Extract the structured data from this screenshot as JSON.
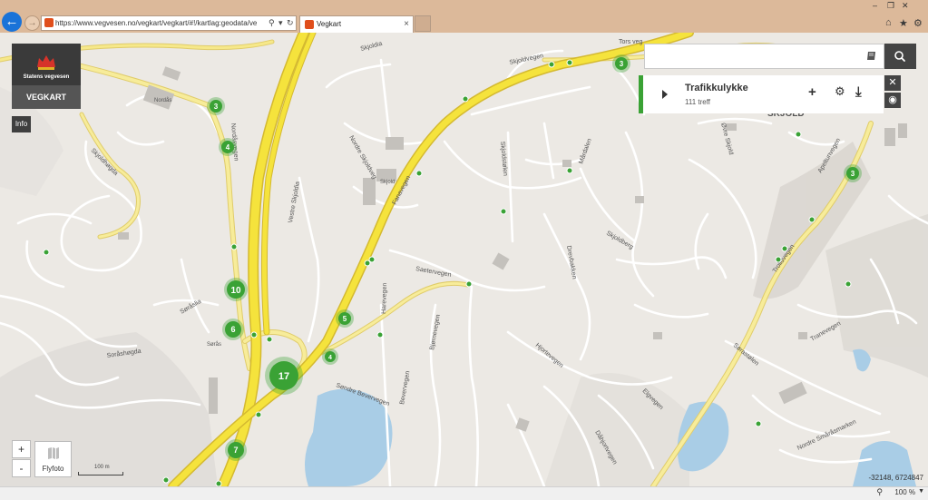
{
  "browser": {
    "url": "https://www.vegvesen.no/vegkart/vegkart/#!/kartlag:geodata/vegre",
    "tab_title": "Vegkart",
    "tab_close": "×",
    "zoom_level": "100 %",
    "icons": [
      "back-icon",
      "forward-icon",
      "search-icon",
      "dropdown-icon",
      "refresh-icon",
      "home-icon",
      "star-icon",
      "gear-icon",
      "minimize-icon",
      "restore-icon",
      "close-icon"
    ]
  },
  "app": {
    "org_name": "Statens vegvesen",
    "app_name": "VEGKART",
    "info_label": "Info",
    "search": {
      "value": "",
      "placeholder": ""
    },
    "result": {
      "title": "Trafikkulykke",
      "count": "111 treff",
      "add_symbol": "+",
      "settings_symbol": "⚙",
      "download_symbol": "⤓"
    },
    "side_close": "✕",
    "side_eye": "◉",
    "zoom_in": "+",
    "zoom_out": "-",
    "flyfoto_label": "Flyfoto",
    "scale_label": "100 m",
    "coords": "-32148, 6724847",
    "accent_color": "#3aa235"
  },
  "map": {
    "place_labels": [
      "SKJOLD",
      "Skjold",
      "Nordås",
      "Sørås"
    ],
    "road_labels": [
      "Skjoldvegen",
      "Skjoldia",
      "Nordre Skjoldveg",
      "Skjoldstølen",
      "Skjoldhøgda",
      "Fanavegen",
      "Nordåsvegen",
      "Vestre Skjoldia",
      "Saetervegen",
      "Søndre Bevervegen",
      "Bevervegen",
      "Harevegen",
      "Bjørnevegen",
      "Hjortevegen",
      "Elgvegen",
      "Skjoldberg",
      "Drevbakken",
      "Apeltunvegen",
      "Trolluvegen",
      "Tranevegen",
      "Sørås­lia",
      "Soråshøgda",
      "Tors veg",
      "Mårdalen",
      "Dåhjortvegen",
      "Nordre Småråsmarken",
      "Øvre Skjold",
      "Sørastølen"
    ],
    "clusters": [
      {
        "count": "3"
      },
      {
        "count": "4"
      },
      {
        "count": "10"
      },
      {
        "count": "6"
      },
      {
        "count": "17"
      },
      {
        "count": "7"
      },
      {
        "count": "5"
      },
      {
        "count": "4"
      },
      {
        "count": "3"
      },
      {
        "count": "3"
      }
    ]
  }
}
